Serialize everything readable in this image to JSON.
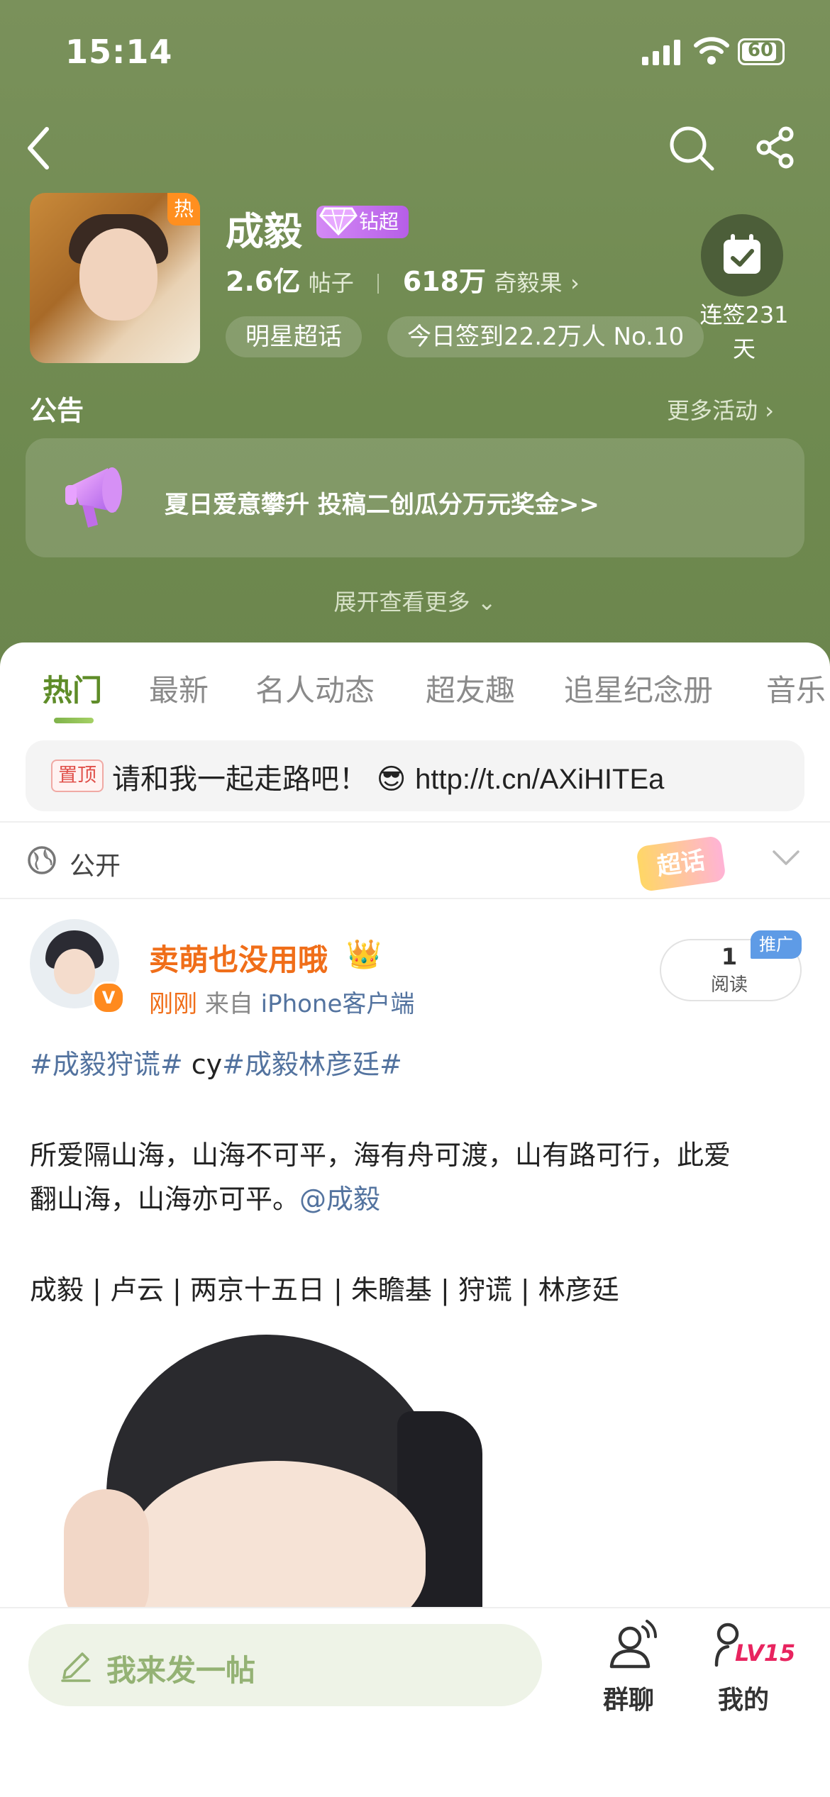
{
  "status_bar": {
    "time": "15:14",
    "battery": "60"
  },
  "header": {
    "title": "成毅",
    "diamond_badge": "钻超",
    "hot_badge": "热",
    "posts_count": "2.6亿",
    "posts_label": "帖子",
    "fans_count": "618万",
    "fans_label": "奇毅果",
    "category_pill": "明星超话",
    "checkin_pill": "今日签到22.2万人 No.10",
    "checkin_streak_line1": "连签231",
    "checkin_streak_line2": "天",
    "colors": {
      "header_bg": "#6f8a50",
      "accent_green": "#5e8c28",
      "orange": "#f06e19",
      "link_blue": "#53739f"
    }
  },
  "notice": {
    "title": "公告",
    "more_label": "更多活动",
    "text": "夏日爱意攀升 投稿二创瓜分万元奖金>>",
    "expand_label": "展开查看更多"
  },
  "tabs": [
    {
      "label": "热门",
      "active": true
    },
    {
      "label": "最新"
    },
    {
      "label": "名人动态"
    },
    {
      "label": "超友趣"
    },
    {
      "label": "追星纪念册"
    },
    {
      "label": "音乐"
    }
  ],
  "pinned": {
    "tag": "置顶",
    "text": "请和我一起走路吧！",
    "emoji": "😎",
    "link": "http://t.cn/AXiHITEa"
  },
  "visibility": {
    "label": "公开",
    "sticker": "超话"
  },
  "post": {
    "username": "卖萌也没用哦",
    "crown_emoji": "👑",
    "time": "刚刚",
    "source_prefix": "来自",
    "source": "iPhone客户端",
    "verified": "V",
    "read_count": "1",
    "read_label": "阅读",
    "promo_badge": "推广",
    "tag1": "#成毅狩谎#",
    "tag_middle": " cy",
    "tag2": "#成毅林彦廷#",
    "body_line1": "所爱隔山海，山海不可平，海有舟可渡，山有路可行，此爱",
    "body_line2": "翻山海，山海亦可平。",
    "mention": "@成毅",
    "credits": "成毅 | 卢云 | 两京十五日 | 朱瞻基  | 狩谎 | 林彦廷"
  },
  "bottom_bar": {
    "compose_placeholder": "我来发一帖",
    "group_chat_label": "群聊",
    "mine_label": "我的",
    "level": "LV15"
  }
}
